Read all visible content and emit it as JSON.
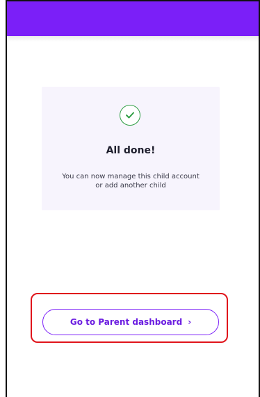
{
  "header": {
    "bar_color": "#7b1ff8"
  },
  "success_card": {
    "icon": "check-circle-icon",
    "title": "All done!",
    "message_line_1": "You can now manage this child account",
    "message_line_2": "or add another child",
    "background_color": "#f7f4fd",
    "icon_color": "#2f9e44"
  },
  "cta": {
    "label": "Go to Parent dashboard",
    "chevron": "›",
    "accent_color": "#7b1ff8"
  },
  "highlight": {
    "color": "#e0141b"
  }
}
